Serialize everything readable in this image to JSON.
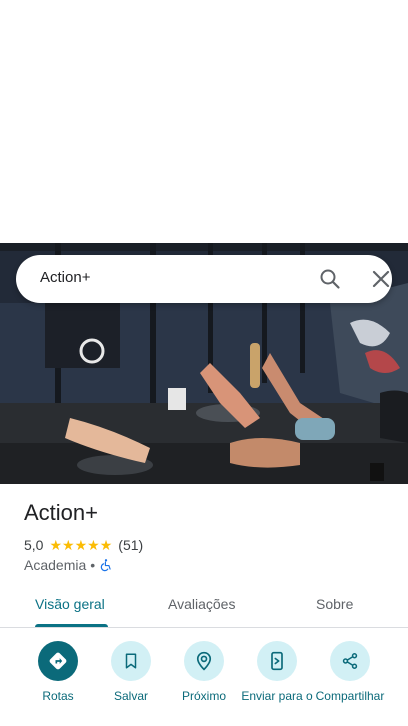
{
  "search": {
    "query": "Action+"
  },
  "place": {
    "name": "Action+",
    "rating": "5,0",
    "stars": 5,
    "reviews_count": "(51)",
    "category": "Academia",
    "separator": "•"
  },
  "tabs": [
    {
      "label": "Visão geral",
      "active": true
    },
    {
      "label": "Avaliações",
      "active": false
    },
    {
      "label": "Sobre",
      "active": false
    }
  ],
  "actions": [
    {
      "label": "Rotas",
      "icon": "directions-icon"
    },
    {
      "label": "Salvar",
      "icon": "bookmark-icon"
    },
    {
      "label": "Próximo",
      "icon": "nearby-icon"
    },
    {
      "label": "Enviar para o",
      "icon": "send-to-phone-icon"
    },
    {
      "label": "Compartilhar",
      "icon": "share-icon"
    }
  ],
  "colors": {
    "accent": "#0b6a7a",
    "star": "#fbbc04"
  }
}
